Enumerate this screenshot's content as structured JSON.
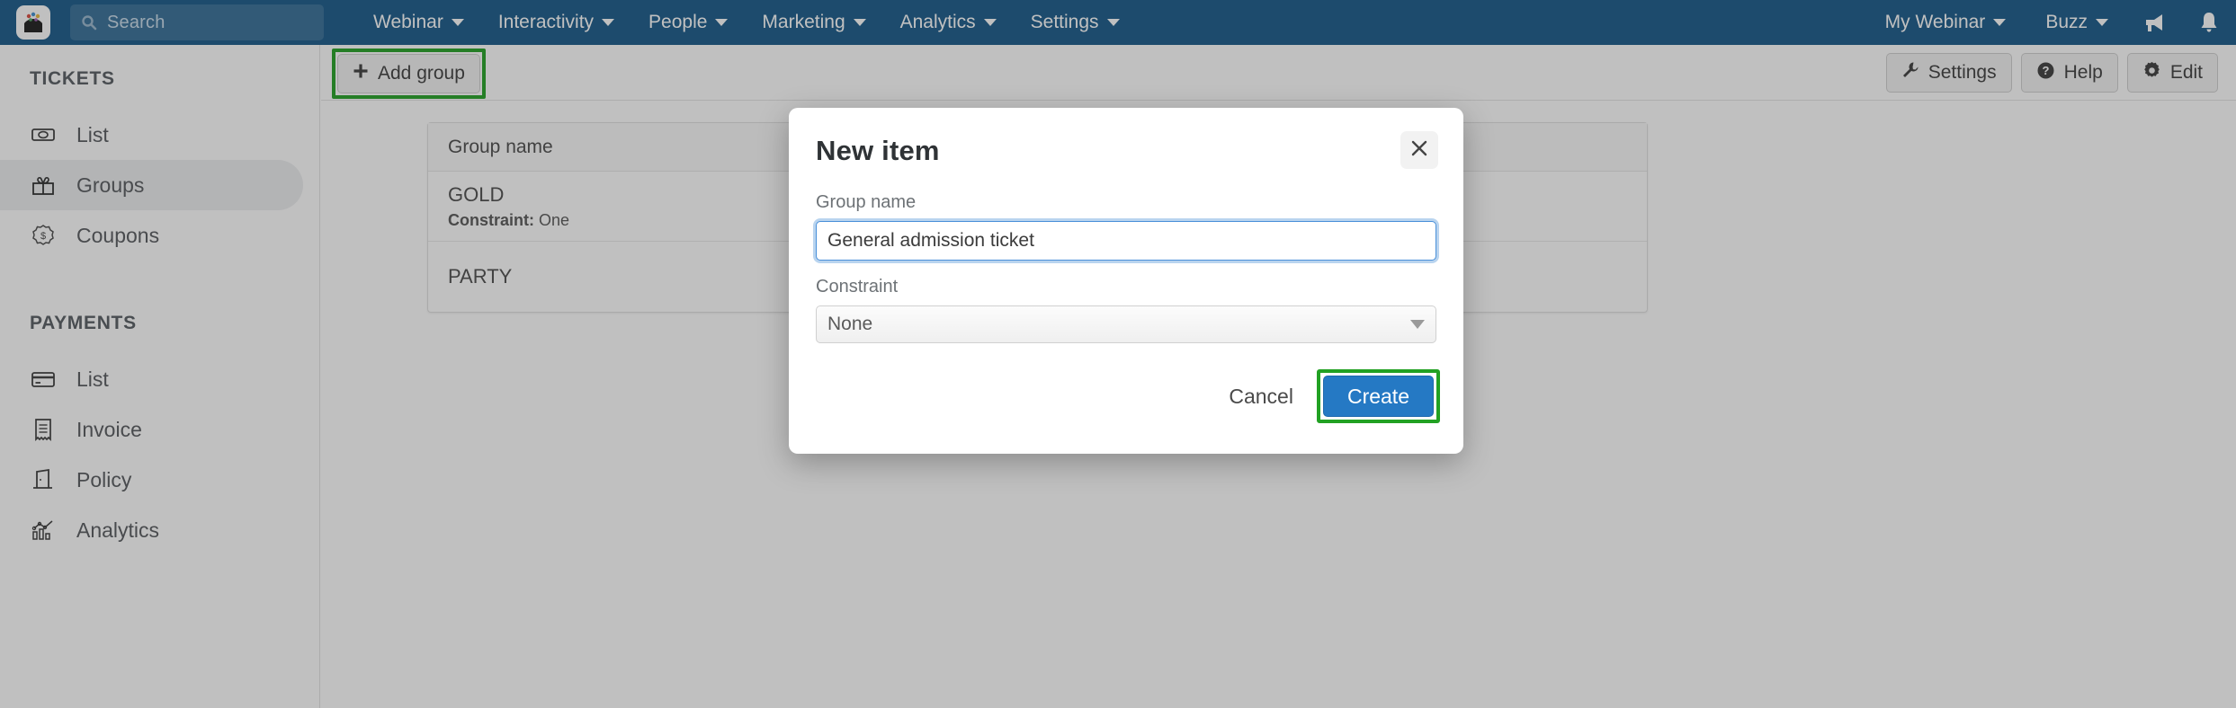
{
  "topnav": {
    "logo_icon": "app-logo-icon",
    "search": {
      "placeholder": "Search",
      "icon": "search-icon",
      "value": ""
    },
    "items": [
      {
        "label": "Webinar"
      },
      {
        "label": "Interactivity"
      },
      {
        "label": "People"
      },
      {
        "label": "Marketing"
      },
      {
        "label": "Analytics"
      },
      {
        "label": "Settings"
      }
    ],
    "right_items": [
      {
        "label": "My Webinar"
      },
      {
        "label": "Buzz"
      }
    ],
    "icons": [
      {
        "name": "megaphone-icon"
      },
      {
        "name": "bell-icon"
      }
    ],
    "bg_color": "#165888"
  },
  "sidebar": {
    "sections": [
      {
        "title": "TICKETS",
        "items": [
          {
            "label": "List",
            "icon": "ticket-icon",
            "active": false
          },
          {
            "label": "Groups",
            "icon": "gift-icon",
            "active": true
          },
          {
            "label": "Coupons",
            "icon": "coupon-dollar-icon",
            "active": false
          }
        ]
      },
      {
        "title": "PAYMENTS",
        "items": [
          {
            "label": "List",
            "icon": "credit-card-icon",
            "active": false
          },
          {
            "label": "Invoice",
            "icon": "receipt-icon",
            "active": false
          },
          {
            "label": "Policy",
            "icon": "door-icon",
            "active": false
          },
          {
            "label": "Analytics",
            "icon": "bar-chart-icon",
            "active": false
          }
        ]
      }
    ]
  },
  "toolbar": {
    "add_group_label": "Add group",
    "add_group_icon": "plus-icon",
    "highlight_color": "#22a123",
    "settings_label": "Settings",
    "settings_icon": "wrench-icon",
    "help_label": "Help",
    "help_icon": "question-circle-icon",
    "edit_label": "Edit",
    "edit_icon": "gear-icon"
  },
  "table": {
    "header": "Group name",
    "rows": [
      {
        "name": "GOLD",
        "sub_label": "Constraint:",
        "sub_value": " One"
      },
      {
        "name": "PARTY",
        "sub_label": "",
        "sub_value": ""
      }
    ]
  },
  "modal": {
    "title": "New item",
    "close_icon": "close-icon",
    "group_name_label": "Group name",
    "group_name_value": "General admission ticket",
    "group_name_placeholder": "Group name",
    "constraint_label": "Constraint",
    "constraint_value": "None",
    "cancel_label": "Cancel",
    "create_label": "Create",
    "create_highlight_color": "#22a123",
    "create_bg_color": "#2579c4"
  }
}
